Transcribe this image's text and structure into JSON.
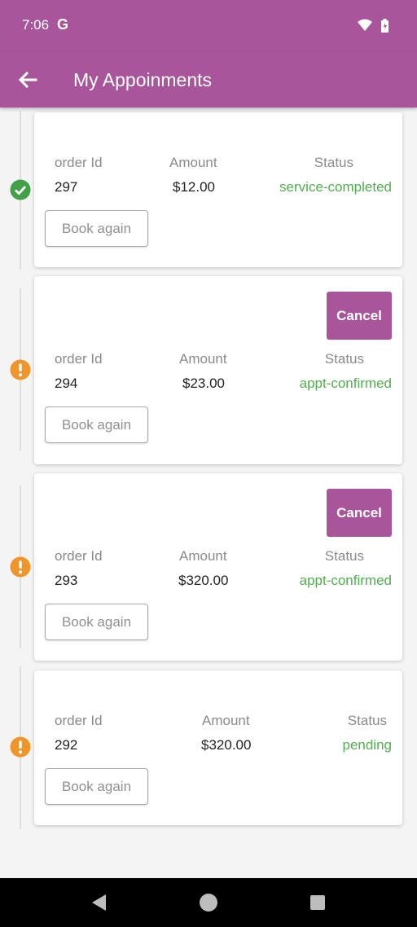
{
  "status_bar": {
    "time": "7:06",
    "g_logo": "G",
    "icons": [
      "wifi-icon",
      "battery-icon"
    ]
  },
  "app_bar": {
    "title": "My Appoinments",
    "back_icon": "arrow-left-icon"
  },
  "labels": {
    "order_id": "order Id",
    "amount": "Amount",
    "status": "Status",
    "book_again": "Book again",
    "cancel": "Cancel"
  },
  "appointments": [
    {
      "order_id": "297",
      "amount": "$12.00",
      "status": "service-completed",
      "state_icon": "check-circle-icon",
      "cancellable": false
    },
    {
      "order_id": "294",
      "amount": "$23.00",
      "status": "appt-confirmed",
      "state_icon": "alert-circle-icon",
      "cancellable": true
    },
    {
      "order_id": "293",
      "amount": "$320.00",
      "status": "appt-confirmed",
      "state_icon": "alert-circle-icon",
      "cancellable": true
    },
    {
      "order_id": "292",
      "amount": "$320.00",
      "status": "pending",
      "state_icon": "alert-circle-icon",
      "cancellable": false
    }
  ],
  "colors": {
    "primary": "#a8559b",
    "status_green": "#52ae4e",
    "check_green": "#43a047",
    "alert_orange": "#f0952a"
  },
  "nav_bar": {
    "buttons": [
      "back-triangle-icon",
      "home-circle-icon",
      "recents-square-icon"
    ]
  }
}
